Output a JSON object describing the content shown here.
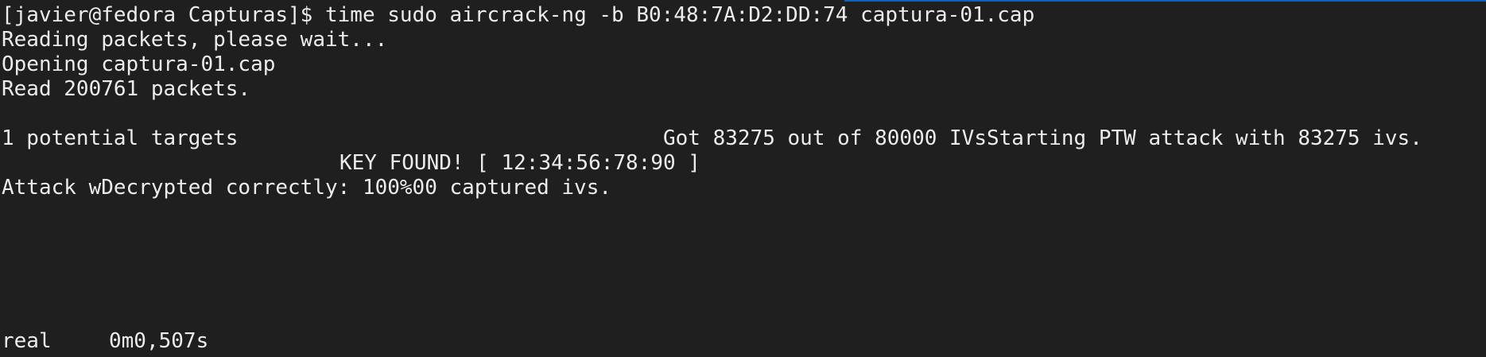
{
  "terminal": {
    "colors": {
      "background": "#1f1f1f",
      "foreground": "#ececec",
      "focus_accent": "#0a63b8"
    },
    "prompt": "[javier@fedora Capturas]$ ",
    "command": "time sudo aircrack-ng -b B0:48:7A:D2:DD:74 captura-01.cap",
    "output": {
      "reading": "Reading packets, please wait...",
      "opening": "Opening captura-01.cap",
      "read_count": "Read 200761 packets.",
      "targets": "1 potential targets",
      "ivs_status": "Got 83275 out of 80000 IVsStarting PTW attack with 83275 ivs.",
      "key_found": "KEY FOUND! [ 12:34:56:78:90 ]",
      "decrypted": "Attack wDecrypted correctly: 100%00 captured ivs.",
      "real_label": "real",
      "real_time": "0m0,507s"
    }
  }
}
